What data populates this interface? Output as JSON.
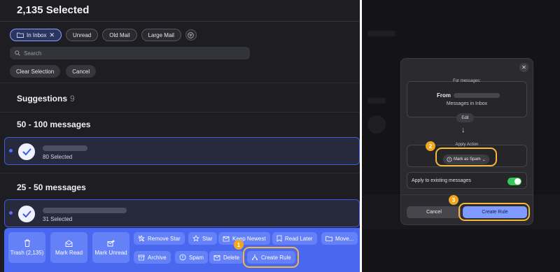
{
  "left": {
    "title": "2,135 Selected",
    "filters": [
      {
        "label": "In Inbox",
        "active": true
      },
      {
        "label": "Unread",
        "active": false
      },
      {
        "label": "Old Mail",
        "active": false
      },
      {
        "label": "Large Mail",
        "active": false
      }
    ],
    "search": {
      "placeholder": "Search"
    },
    "clear_selection": "Clear Selection",
    "cancel": "Cancel",
    "suggestions": {
      "label": "Suggestions",
      "count": "9"
    },
    "groups": [
      {
        "heading": "50 - 100 messages",
        "selected": "80 Selected"
      },
      {
        "heading": "25 - 50 messages",
        "selected": "31 Selected"
      }
    ],
    "actions": {
      "trash": "Trash (2,135)",
      "mark_read": "Mark Read",
      "mark_unread": "Mark Unread",
      "remove_star": "Remove Star",
      "star": "Star",
      "keep_newest": "Keep Newest",
      "read_later": "Read Later",
      "move": "Move...",
      "archive": "Archive",
      "spam": "Spam",
      "delete": "Delete",
      "create_rule": "Create Rule"
    },
    "step1": "1"
  },
  "modal": {
    "for_messages": "For messages:",
    "from": "From",
    "messages_in": "Messages in Inbox",
    "edit": "Edit",
    "apply_action": "Apply Action",
    "action": "Mark as Spam",
    "apply_existing": "Apply to existing messages",
    "apply_existing_on": true,
    "cancel": "Cancel",
    "create_rule": "Create Rule",
    "step2": "2",
    "step3": "3"
  },
  "colors": {
    "accent": "#4a67f0",
    "highlight": "#f5b83a",
    "toggle_on": "#34c759"
  }
}
